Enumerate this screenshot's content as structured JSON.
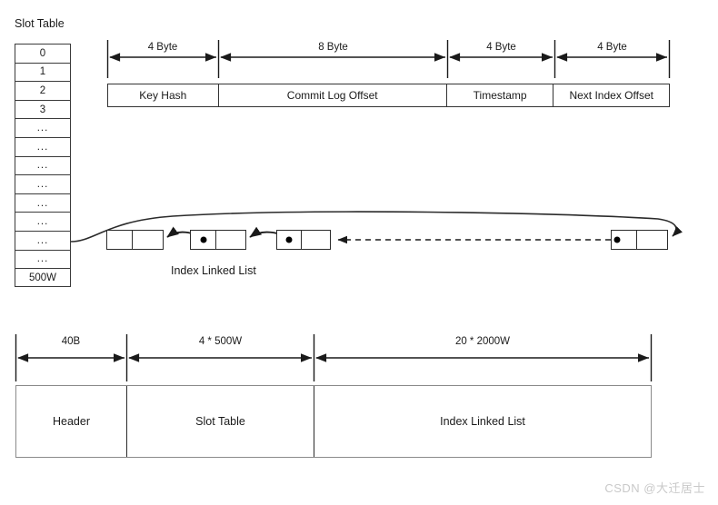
{
  "slot_table": {
    "title": "Slot Table",
    "rows": [
      "0",
      "1",
      "2",
      "3",
      "...",
      "...",
      "...",
      "...",
      "...",
      "...",
      "...",
      "...",
      "500W"
    ]
  },
  "index_entry": {
    "sizes": [
      "4 Byte",
      "8 Byte",
      "4 Byte",
      "4 Byte"
    ],
    "fields": [
      "Key Hash",
      "Commit Log Offset",
      "Timestamp",
      "Next Index Offset"
    ]
  },
  "linked_list": {
    "label": "Index Linked List"
  },
  "file_layout": {
    "sizes": [
      "40B",
      "4 * 500W",
      "20 * 2000W"
    ],
    "sections": [
      "Header",
      "Slot Table",
      "Index Linked List"
    ]
  },
  "watermark": {
    "text": "CSDN @大迁居士"
  },
  "colors": {
    "line": "#2b2b2b",
    "box_border": "#333333",
    "layout_border": "#8a8a8a",
    "text": "#1a1a1a",
    "watermark": "#c9c9c9"
  }
}
